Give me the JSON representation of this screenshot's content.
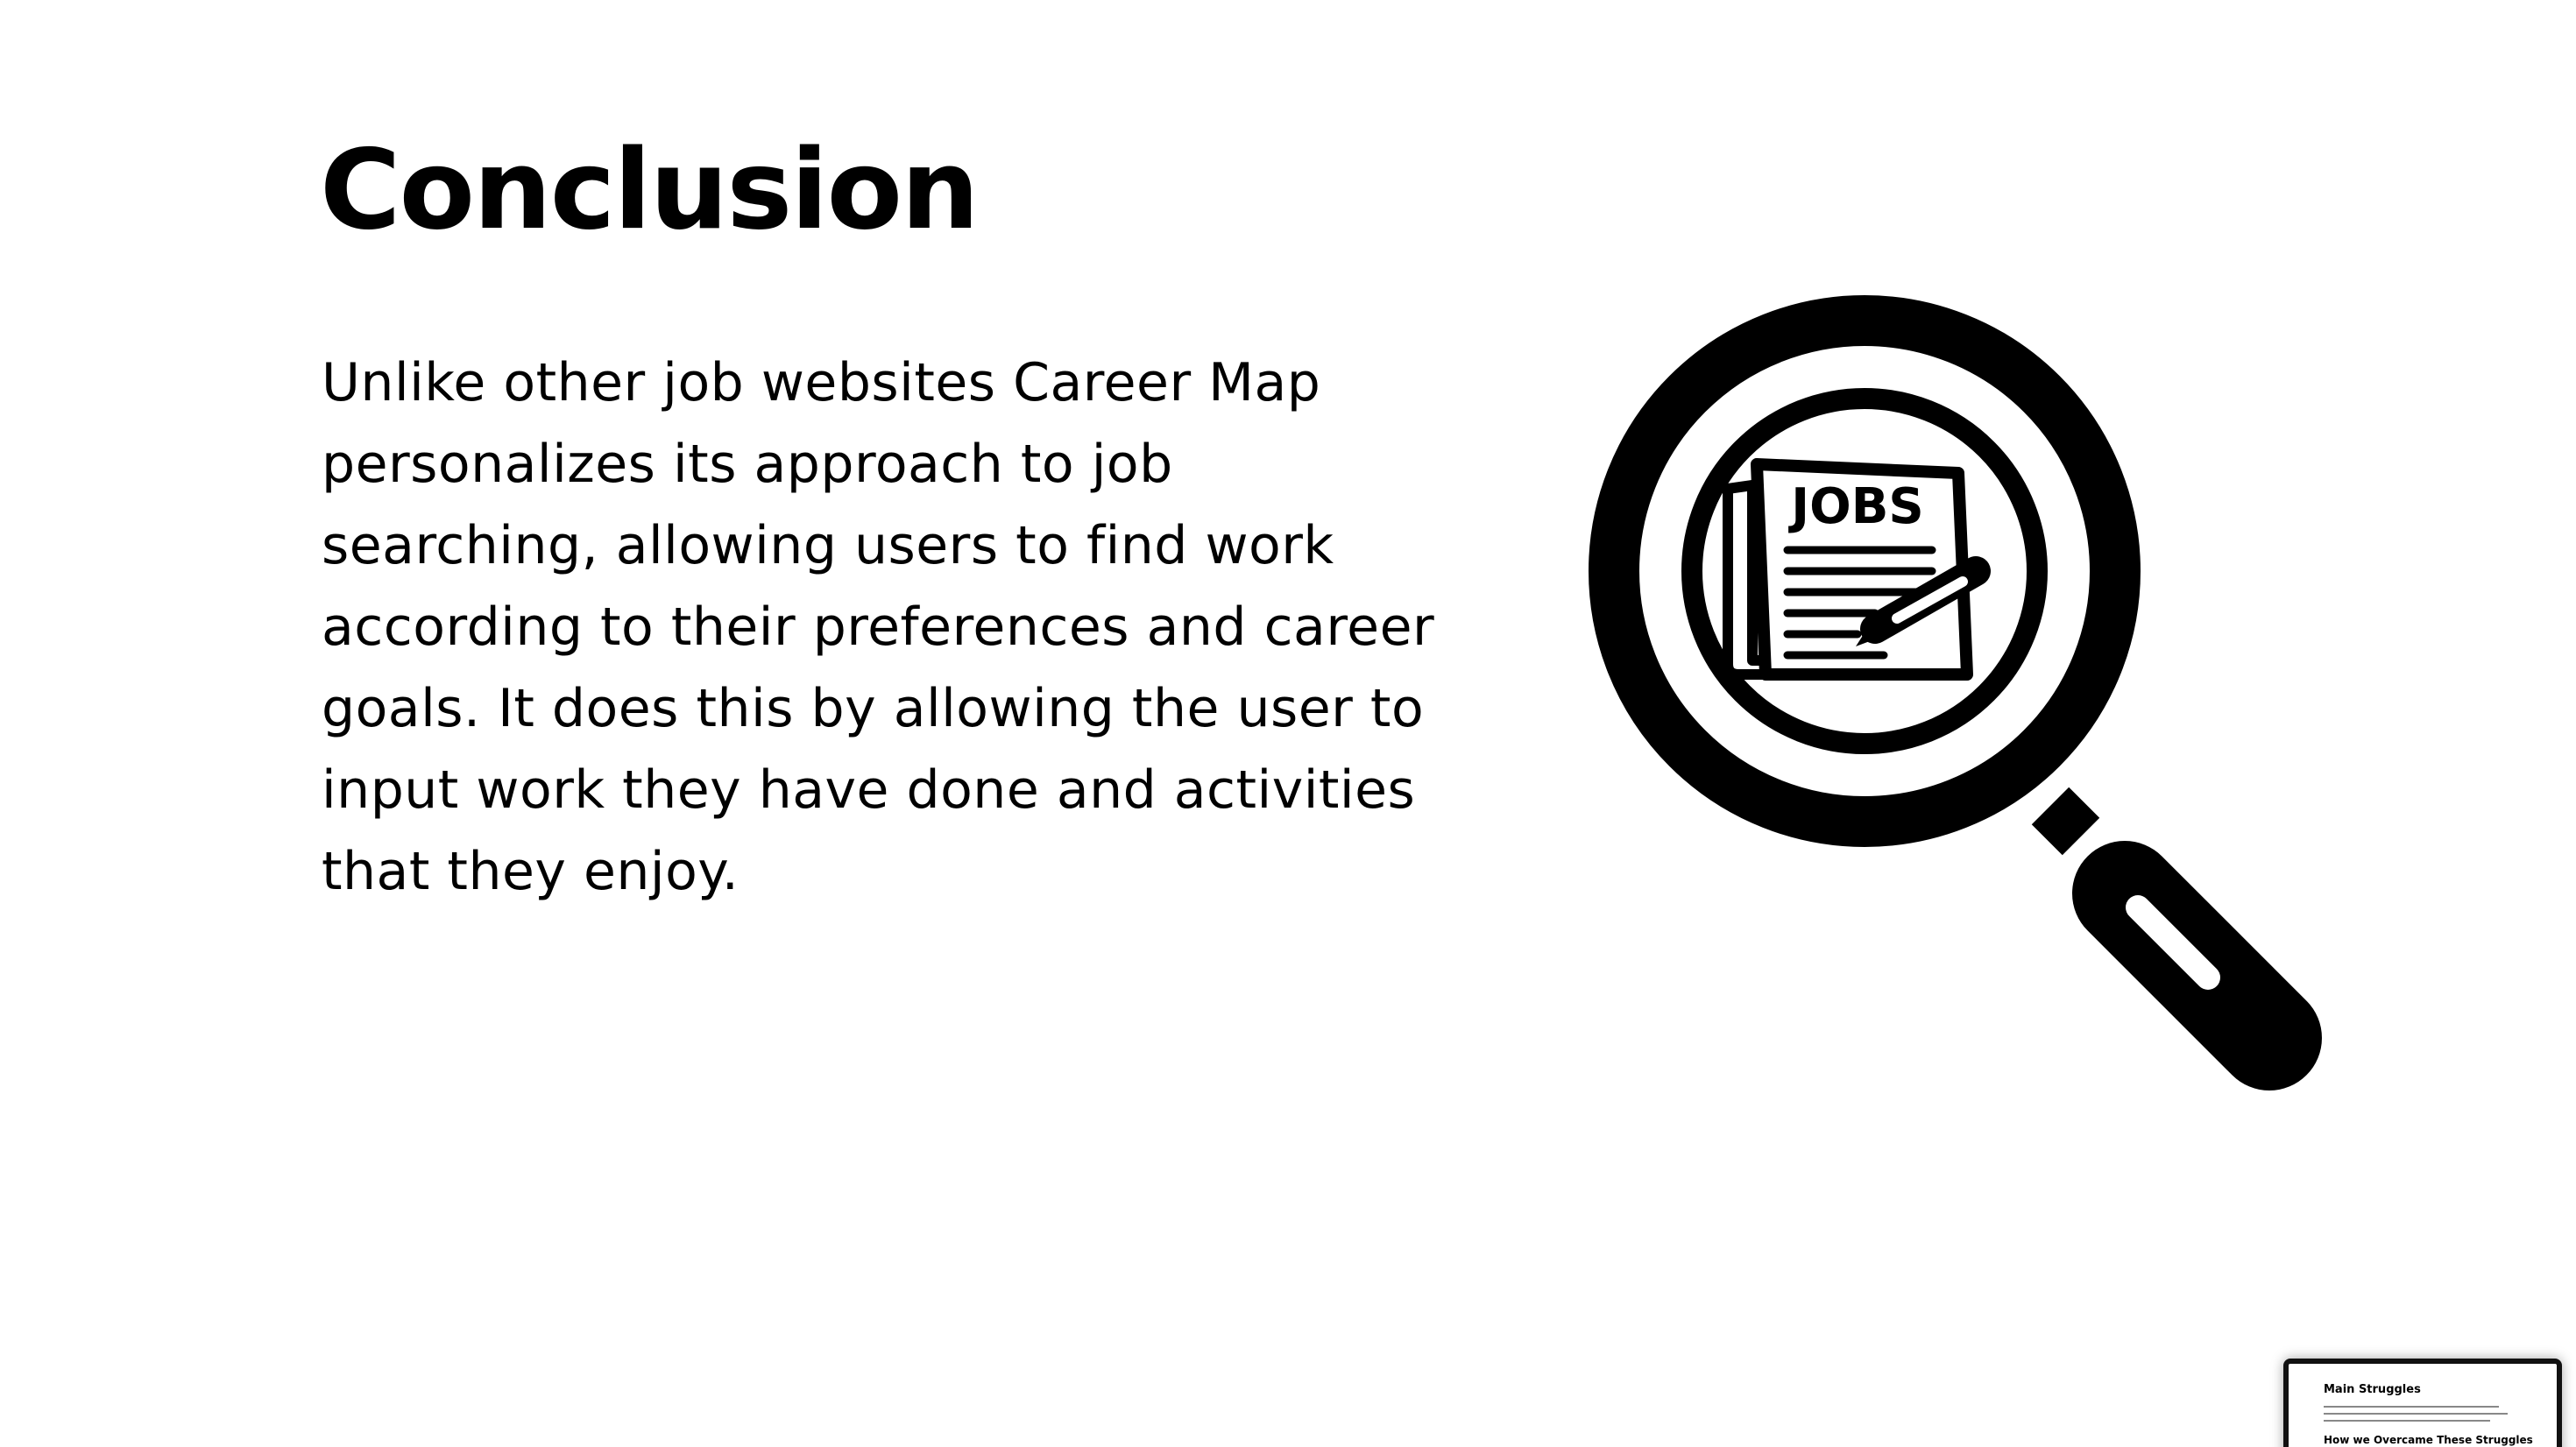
{
  "slide": {
    "title": "Conclusion",
    "body": "Unlike other job websites Career Map personalizes its approach to job searching, allowing users to find work according to their preferences and career goals. It does this by allowing the user to input work they have done and activities that they enjoy."
  },
  "illustration": {
    "icon": "magnifying-glass-jobs-newspaper",
    "label": "JOBS"
  },
  "thumbnail": {
    "heading": "Main Struggles",
    "subheading": "How we Overcame These Struggles"
  },
  "colors": {
    "background": "#ffffff",
    "text": "#000000"
  }
}
